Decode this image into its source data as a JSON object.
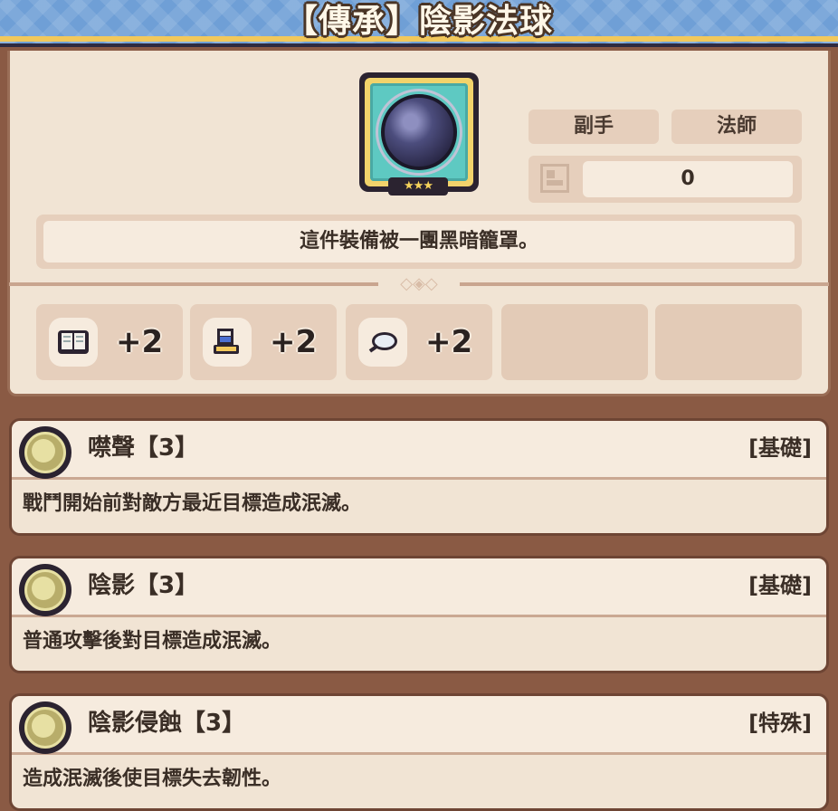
{
  "item": {
    "title": "【傳承】陰影法球",
    "stars": "★★★",
    "slot": "副手",
    "class": "法師",
    "stat_value": "0",
    "description": "這件裝備被一團黑暗籠罩。"
  },
  "attributes": [
    {
      "icon": "book-icon",
      "value": "+2"
    },
    {
      "icon": "boot-icon",
      "value": "+2"
    },
    {
      "icon": "feather-icon",
      "value": "+2"
    }
  ],
  "skills": [
    {
      "name": "噤聲【3】",
      "type": "[基礎]",
      "description": "戰鬥開始前對敵方最近目標造成泯滅。"
    },
    {
      "name": "陰影【3】",
      "type": "[基礎]",
      "description": "普通攻擊後對目標造成泯滅。"
    },
    {
      "name": "陰影侵蝕【3】",
      "type": "[特殊]",
      "description": "造成泯滅後使目標失去韌性。"
    }
  ],
  "colors": {
    "banner": "#6f9fd6",
    "panel": "#f1e4d4",
    "orb_bg": "#5ec9c2"
  }
}
